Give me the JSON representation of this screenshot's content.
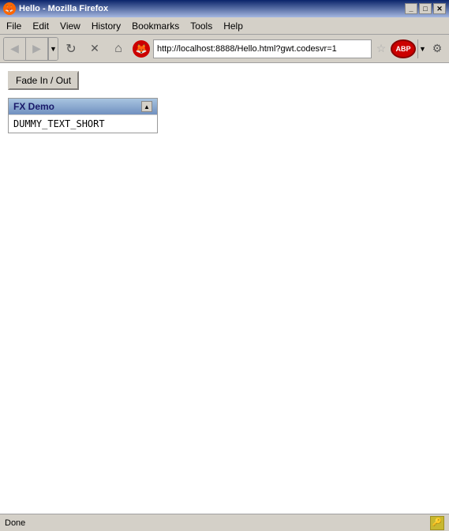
{
  "window": {
    "title": "Hello - Mozilla Firefox",
    "title_icon": "🦊"
  },
  "title_controls": {
    "minimize": "_",
    "maximize": "□",
    "close": "✕"
  },
  "menu": {
    "items": [
      {
        "label": "File"
      },
      {
        "label": "Edit"
      },
      {
        "label": "View"
      },
      {
        "label": "History"
      },
      {
        "label": "Bookmarks"
      },
      {
        "label": "Tools"
      },
      {
        "label": "Help"
      }
    ]
  },
  "nav": {
    "back_arrow": "◀",
    "forward_arrow": "▶",
    "dropdown_arrow": "▼",
    "refresh": "↻",
    "stop": "✕",
    "home": "⌂",
    "url": "http://localhost:8888/Hello.html?gwt.codesvr=1",
    "star": "☆",
    "abp_label": "ABP",
    "gear": "⚙"
  },
  "page": {
    "fade_button_label": "Fade In / Out",
    "fx_panel": {
      "title": "FX Demo",
      "scroll_arrow": "▲",
      "content_text": "DUMMY_TEXT_SHORT"
    }
  },
  "status_bar": {
    "text": "Done",
    "icon": "🔑"
  }
}
